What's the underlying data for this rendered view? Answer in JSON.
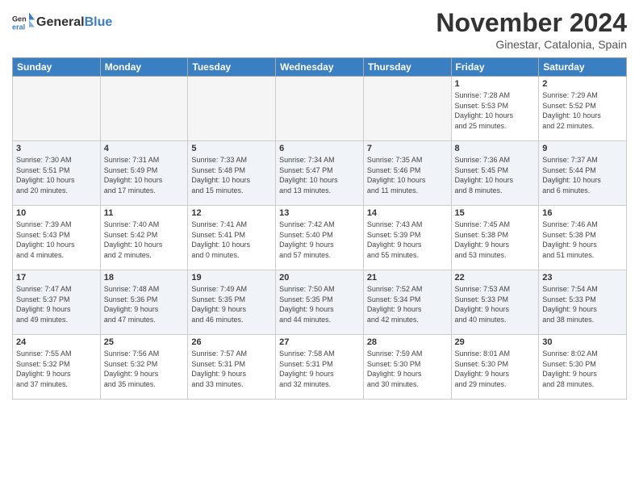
{
  "header": {
    "logo_line1": "General",
    "logo_line2": "Blue",
    "month_title": "November 2024",
    "location": "Ginestar, Catalonia, Spain"
  },
  "weekdays": [
    "Sunday",
    "Monday",
    "Tuesday",
    "Wednesday",
    "Thursday",
    "Friday",
    "Saturday"
  ],
  "weeks": [
    [
      {
        "day": "",
        "info": "",
        "empty": true
      },
      {
        "day": "",
        "info": "",
        "empty": true
      },
      {
        "day": "",
        "info": "",
        "empty": true
      },
      {
        "day": "",
        "info": "",
        "empty": true
      },
      {
        "day": "",
        "info": "",
        "empty": true
      },
      {
        "day": "1",
        "info": "Sunrise: 7:28 AM\nSunset: 5:53 PM\nDaylight: 10 hours\nand 25 minutes.",
        "empty": false
      },
      {
        "day": "2",
        "info": "Sunrise: 7:29 AM\nSunset: 5:52 PM\nDaylight: 10 hours\nand 22 minutes.",
        "empty": false
      }
    ],
    [
      {
        "day": "3",
        "info": "Sunrise: 7:30 AM\nSunset: 5:51 PM\nDaylight: 10 hours\nand 20 minutes.",
        "empty": false
      },
      {
        "day": "4",
        "info": "Sunrise: 7:31 AM\nSunset: 5:49 PM\nDaylight: 10 hours\nand 17 minutes.",
        "empty": false
      },
      {
        "day": "5",
        "info": "Sunrise: 7:33 AM\nSunset: 5:48 PM\nDaylight: 10 hours\nand 15 minutes.",
        "empty": false
      },
      {
        "day": "6",
        "info": "Sunrise: 7:34 AM\nSunset: 5:47 PM\nDaylight: 10 hours\nand 13 minutes.",
        "empty": false
      },
      {
        "day": "7",
        "info": "Sunrise: 7:35 AM\nSunset: 5:46 PM\nDaylight: 10 hours\nand 11 minutes.",
        "empty": false
      },
      {
        "day": "8",
        "info": "Sunrise: 7:36 AM\nSunset: 5:45 PM\nDaylight: 10 hours\nand 8 minutes.",
        "empty": false
      },
      {
        "day": "9",
        "info": "Sunrise: 7:37 AM\nSunset: 5:44 PM\nDaylight: 10 hours\nand 6 minutes.",
        "empty": false
      }
    ],
    [
      {
        "day": "10",
        "info": "Sunrise: 7:39 AM\nSunset: 5:43 PM\nDaylight: 10 hours\nand 4 minutes.",
        "empty": false
      },
      {
        "day": "11",
        "info": "Sunrise: 7:40 AM\nSunset: 5:42 PM\nDaylight: 10 hours\nand 2 minutes.",
        "empty": false
      },
      {
        "day": "12",
        "info": "Sunrise: 7:41 AM\nSunset: 5:41 PM\nDaylight: 10 hours\nand 0 minutes.",
        "empty": false
      },
      {
        "day": "13",
        "info": "Sunrise: 7:42 AM\nSunset: 5:40 PM\nDaylight: 9 hours\nand 57 minutes.",
        "empty": false
      },
      {
        "day": "14",
        "info": "Sunrise: 7:43 AM\nSunset: 5:39 PM\nDaylight: 9 hours\nand 55 minutes.",
        "empty": false
      },
      {
        "day": "15",
        "info": "Sunrise: 7:45 AM\nSunset: 5:38 PM\nDaylight: 9 hours\nand 53 minutes.",
        "empty": false
      },
      {
        "day": "16",
        "info": "Sunrise: 7:46 AM\nSunset: 5:38 PM\nDaylight: 9 hours\nand 51 minutes.",
        "empty": false
      }
    ],
    [
      {
        "day": "17",
        "info": "Sunrise: 7:47 AM\nSunset: 5:37 PM\nDaylight: 9 hours\nand 49 minutes.",
        "empty": false
      },
      {
        "day": "18",
        "info": "Sunrise: 7:48 AM\nSunset: 5:36 PM\nDaylight: 9 hours\nand 47 minutes.",
        "empty": false
      },
      {
        "day": "19",
        "info": "Sunrise: 7:49 AM\nSunset: 5:35 PM\nDaylight: 9 hours\nand 46 minutes.",
        "empty": false
      },
      {
        "day": "20",
        "info": "Sunrise: 7:50 AM\nSunset: 5:35 PM\nDaylight: 9 hours\nand 44 minutes.",
        "empty": false
      },
      {
        "day": "21",
        "info": "Sunrise: 7:52 AM\nSunset: 5:34 PM\nDaylight: 9 hours\nand 42 minutes.",
        "empty": false
      },
      {
        "day": "22",
        "info": "Sunrise: 7:53 AM\nSunset: 5:33 PM\nDaylight: 9 hours\nand 40 minutes.",
        "empty": false
      },
      {
        "day": "23",
        "info": "Sunrise: 7:54 AM\nSunset: 5:33 PM\nDaylight: 9 hours\nand 38 minutes.",
        "empty": false
      }
    ],
    [
      {
        "day": "24",
        "info": "Sunrise: 7:55 AM\nSunset: 5:32 PM\nDaylight: 9 hours\nand 37 minutes.",
        "empty": false
      },
      {
        "day": "25",
        "info": "Sunrise: 7:56 AM\nSunset: 5:32 PM\nDaylight: 9 hours\nand 35 minutes.",
        "empty": false
      },
      {
        "day": "26",
        "info": "Sunrise: 7:57 AM\nSunset: 5:31 PM\nDaylight: 9 hours\nand 33 minutes.",
        "empty": false
      },
      {
        "day": "27",
        "info": "Sunrise: 7:58 AM\nSunset: 5:31 PM\nDaylight: 9 hours\nand 32 minutes.",
        "empty": false
      },
      {
        "day": "28",
        "info": "Sunrise: 7:59 AM\nSunset: 5:30 PM\nDaylight: 9 hours\nand 30 minutes.",
        "empty": false
      },
      {
        "day": "29",
        "info": "Sunrise: 8:01 AM\nSunset: 5:30 PM\nDaylight: 9 hours\nand 29 minutes.",
        "empty": false
      },
      {
        "day": "30",
        "info": "Sunrise: 8:02 AM\nSunset: 5:30 PM\nDaylight: 9 hours\nand 28 minutes.",
        "empty": false
      }
    ]
  ]
}
